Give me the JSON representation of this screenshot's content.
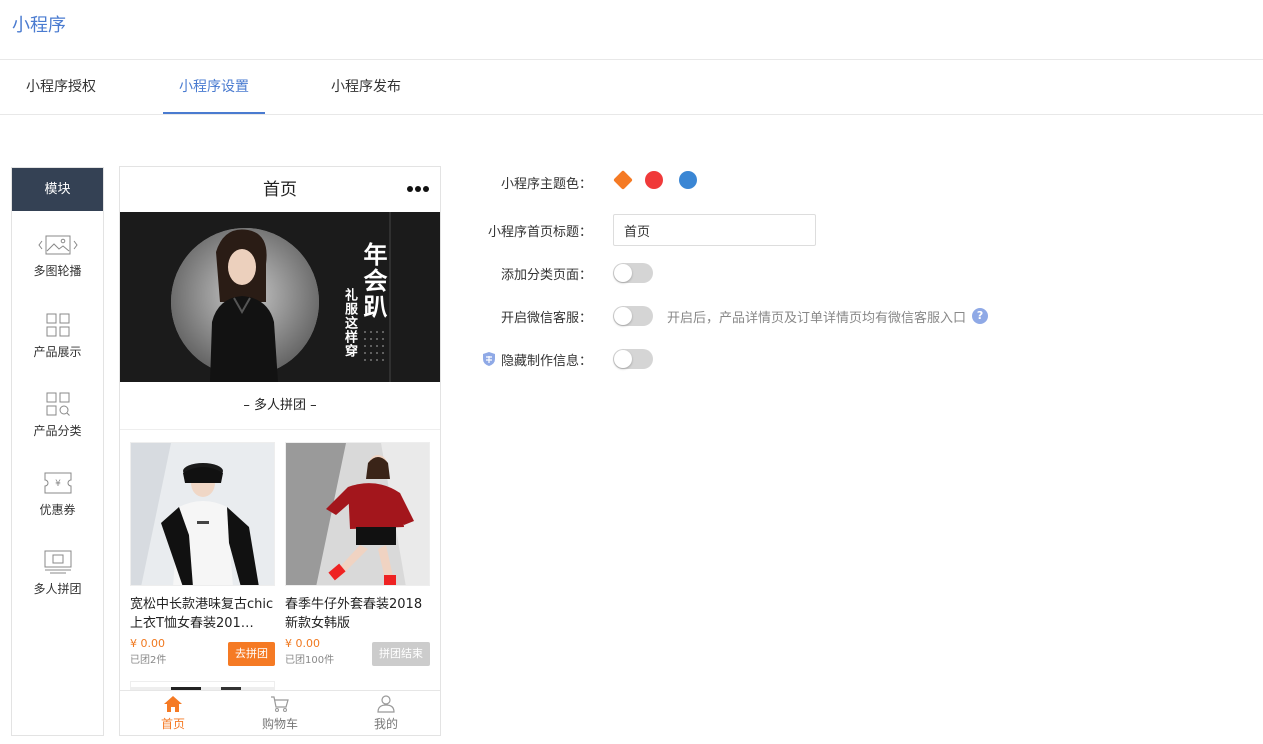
{
  "app": {
    "title": "小程序"
  },
  "tabs": [
    {
      "label": "小程序授权"
    },
    {
      "label": "小程序设置"
    },
    {
      "label": "小程序发布"
    }
  ],
  "modules": {
    "header": "模块",
    "items": [
      {
        "label": "多图轮播",
        "icon": "carousel-icon"
      },
      {
        "label": "产品展示",
        "icon": "grid-icon"
      },
      {
        "label": "产品分类",
        "icon": "category-search-icon"
      },
      {
        "label": "优惠券",
        "icon": "coupon-icon"
      },
      {
        "label": "多人拼团",
        "icon": "group-buy-icon"
      }
    ]
  },
  "phone": {
    "title": "首页",
    "banner": {
      "big_text": "年会趴",
      "small_text": "礼服这样穿"
    },
    "section_title": "– 多人拼团 –",
    "products": [
      {
        "name": "宽松中长款港味复古chic上衣T恤女春装201…",
        "price": "¥ 0.00",
        "sold": "已团2件",
        "button": "去拼团",
        "state": "active"
      },
      {
        "name": "春季牛仔外套春装2018新款女韩版",
        "price": "¥ 0.00",
        "sold": "已团100件",
        "button": "拼团结束",
        "state": "ended"
      }
    ],
    "nav": [
      {
        "label": "首页",
        "icon": "home-icon"
      },
      {
        "label": "购物车",
        "icon": "cart-icon"
      },
      {
        "label": "我的",
        "icon": "user-icon"
      }
    ]
  },
  "settings": {
    "theme_color": {
      "label": "小程序主题色：",
      "colors": [
        "#f57a24",
        "#f03a3a",
        "#3a86d4"
      ]
    },
    "home_title": {
      "label": "小程序首页标题：",
      "value": "首页"
    },
    "category_page": {
      "label": "添加分类页面：",
      "enabled": false
    },
    "wechat_service": {
      "label": "开启微信客服：",
      "enabled": false,
      "hint": "开启后，产品详情页及订单详情页均有微信客服入口",
      "help": "?"
    },
    "hide_info": {
      "label": "隐藏制作信息：",
      "enabled": false,
      "badge_icon": "vip-badge-icon"
    }
  },
  "colors": {
    "accent": "#4a7bd0",
    "orange": "#f57a24",
    "dark": "#344154"
  }
}
